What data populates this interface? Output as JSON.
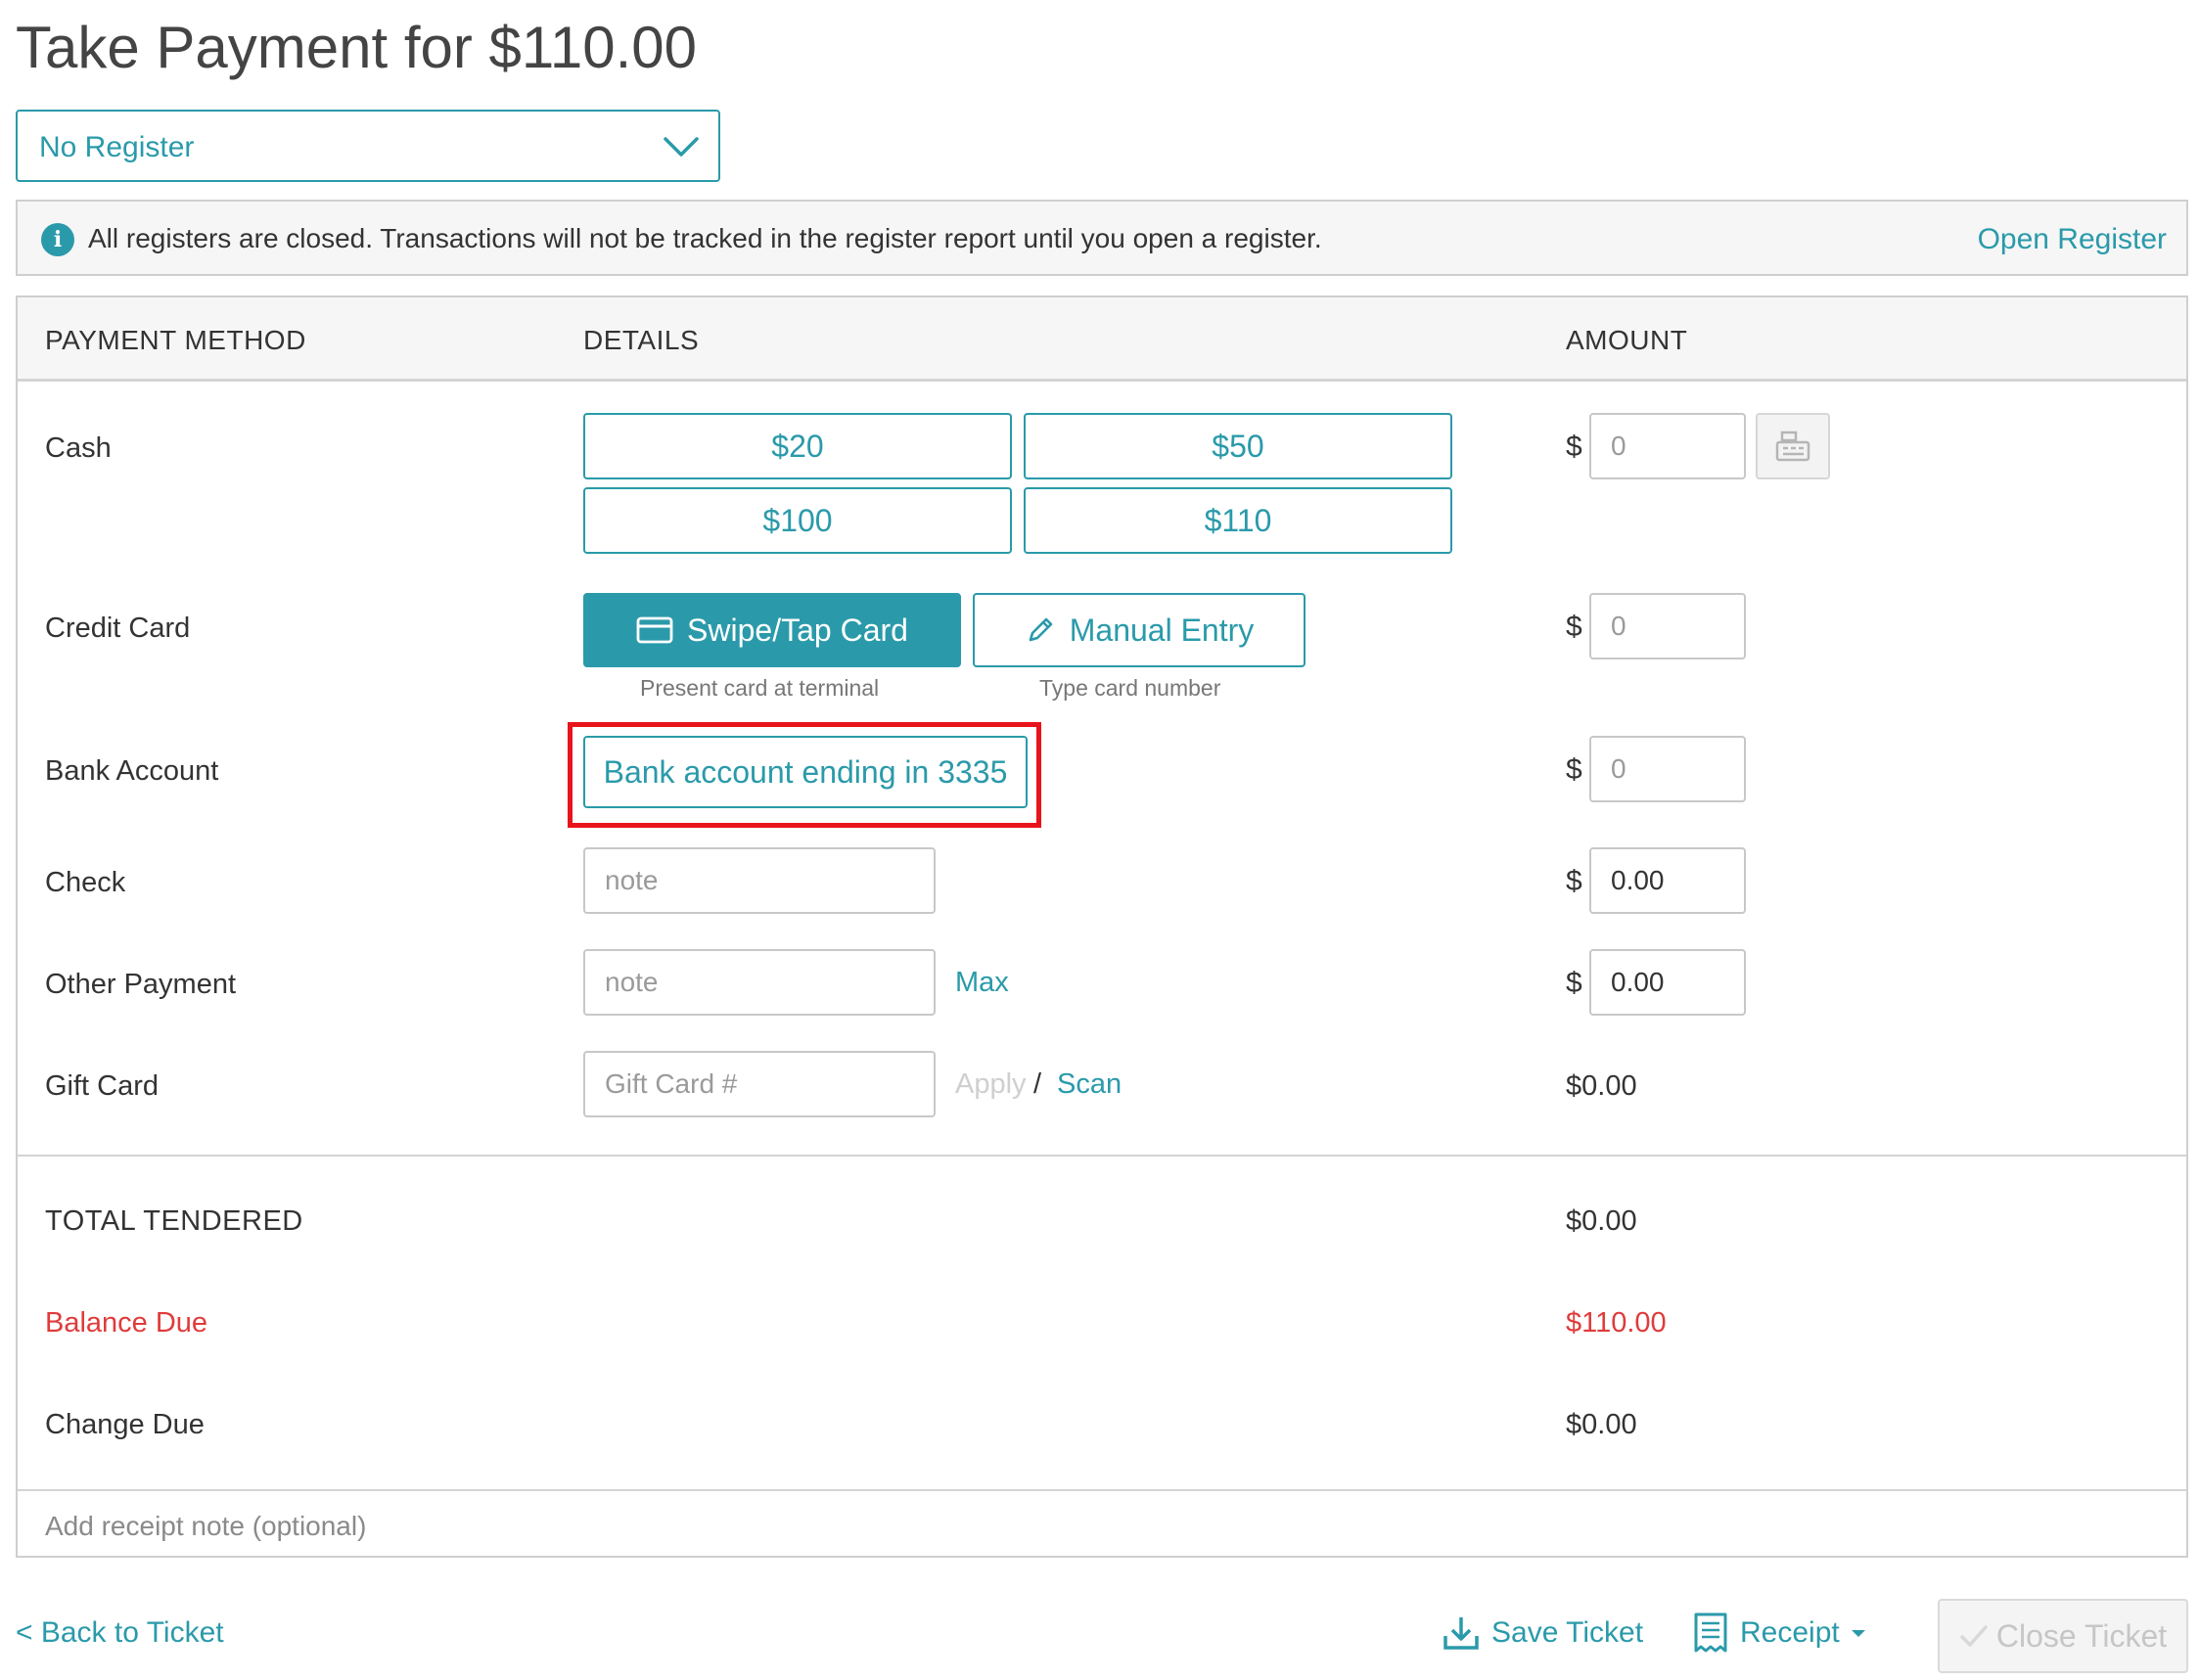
{
  "header": {
    "title": "Take Payment for $110.00"
  },
  "register": {
    "selected": "No Register"
  },
  "notice": {
    "message": "All registers are closed. Transactions will not be tracked in the register report until you open a register.",
    "action": "Open Register"
  },
  "table": {
    "columns": [
      "PAYMENT METHOD",
      "DETAILS",
      "AMOUNT"
    ],
    "currency_symbol": "$"
  },
  "cash": {
    "label": "Cash",
    "quick_amounts": [
      "$20",
      "$50",
      "$100",
      "$110"
    ],
    "amount_placeholder": "0"
  },
  "credit_card": {
    "label": "Credit Card",
    "swipe_label": "Swipe/Tap Card",
    "swipe_hint": "Present card at terminal",
    "manual_label": "Manual Entry",
    "manual_hint": "Type card number",
    "amount_placeholder": "0"
  },
  "bank_account": {
    "label": "Bank Account",
    "account_button": "Bank account ending in 3335",
    "amount_placeholder": "0"
  },
  "check": {
    "label": "Check",
    "note_placeholder": "note",
    "amount_value": "0.00"
  },
  "other_payment": {
    "label": "Other Payment",
    "note_placeholder": "note",
    "max_label": "Max",
    "amount_value": "0.00"
  },
  "gift_card": {
    "label": "Gift Card",
    "number_placeholder": "Gift Card #",
    "apply_label": "Apply",
    "separator": "/",
    "scan_label": "Scan",
    "amount": "$0.00"
  },
  "summary": {
    "total_tendered_label": "TOTAL TENDERED",
    "total_tendered_value": "$0.00",
    "balance_due_label": "Balance Due",
    "balance_due_value": "$110.00",
    "change_due_label": "Change Due",
    "change_due_value": "$0.00"
  },
  "receipt_note": {
    "placeholder": "Add receipt note (optional)"
  },
  "footer": {
    "back_label": "< Back to Ticket",
    "save_label": "Save Ticket",
    "receipt_label": "Receipt",
    "close_label": "Close Ticket"
  },
  "colors": {
    "accent": "#2a9aaa",
    "danger": "#e03b3b",
    "highlight": "#e8141b"
  }
}
